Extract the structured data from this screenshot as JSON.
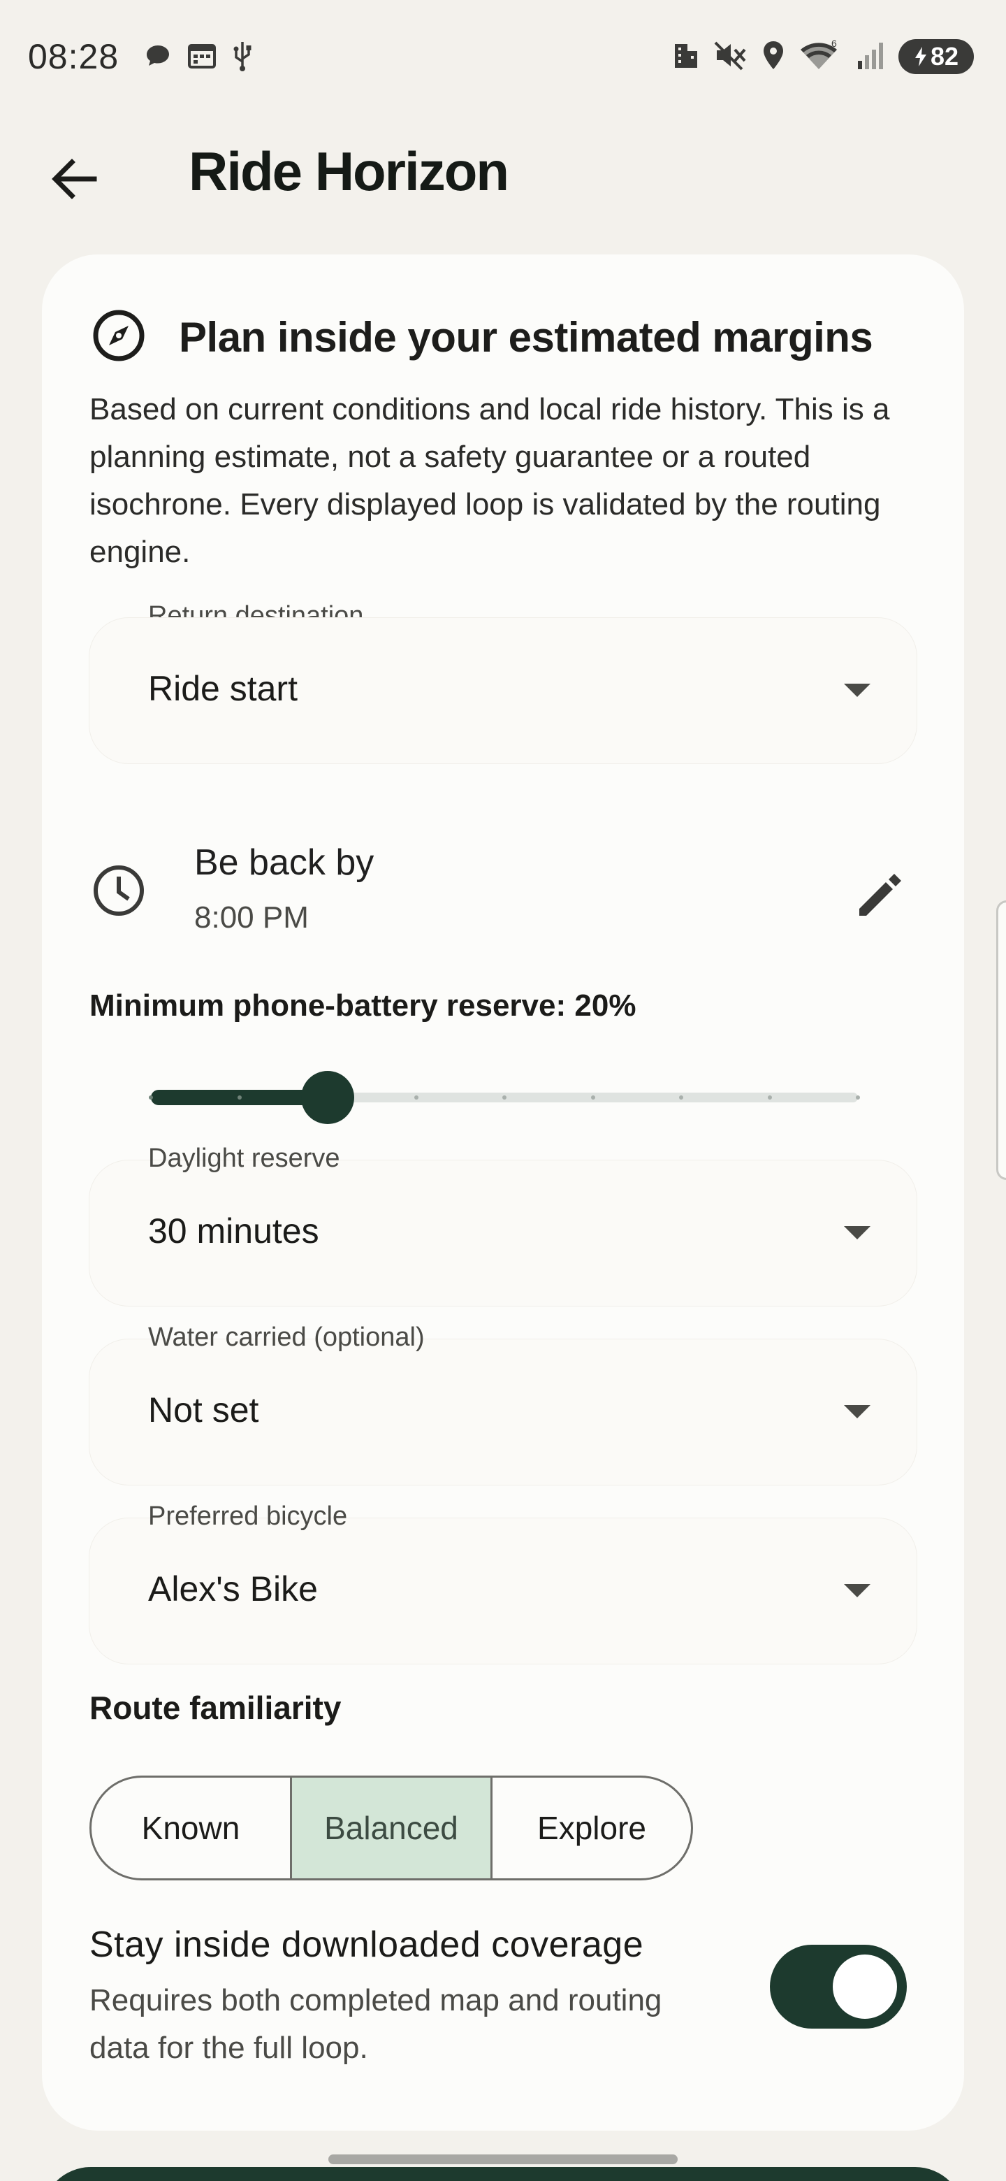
{
  "status_bar": {
    "time": "08:28",
    "battery_percent": "82",
    "left_icons": [
      "chat-bubble-icon",
      "calendar-icon",
      "usb-icon"
    ],
    "right_icons": [
      "building-icon",
      "mute-icon",
      "location-icon",
      "wifi-icon",
      "signal-icon",
      "battery-charging-icon"
    ]
  },
  "app_bar": {
    "title": "Ride Horizon",
    "back_icon": "arrow-back-icon"
  },
  "card": {
    "title": "Plan inside your estimated margins",
    "title_icon": "compass-icon",
    "description": "Based on current conditions and local ride history. This is a planning estimate, not a safety guarantee or a routed isochrone. Every displayed loop is validated by the routing engine.",
    "return_destination": {
      "label": "Return destination",
      "value": "Ride start"
    },
    "be_back": {
      "title": "Be back by",
      "value": "8:00 PM",
      "icon": "clock-icon",
      "edit_icon": "pencil-icon"
    },
    "battery_reserve": {
      "label": "Minimum phone-battery reserve: 20%",
      "value_fraction": 0.25,
      "steps": 9
    },
    "daylight_reserve": {
      "label": "Daylight reserve",
      "value": "30 minutes"
    },
    "water_carried": {
      "label": "Water carried (optional)",
      "value": "Not set"
    },
    "preferred_bicycle": {
      "label": "Preferred bicycle",
      "value": "Alex's Bike"
    },
    "route_familiarity": {
      "title": "Route familiarity",
      "options": [
        "Known",
        "Balanced",
        "Explore"
      ],
      "selected": "Balanced"
    },
    "coverage": {
      "title": "Stay inside downloaded coverage",
      "description": "Requires both completed map and routing data for the full loop.",
      "enabled": true
    }
  },
  "colors": {
    "accent": "#1d3a2e",
    "selected_segment": "#d3e6d7",
    "background": "#f3f1ec",
    "card": "#fcfcfa"
  }
}
